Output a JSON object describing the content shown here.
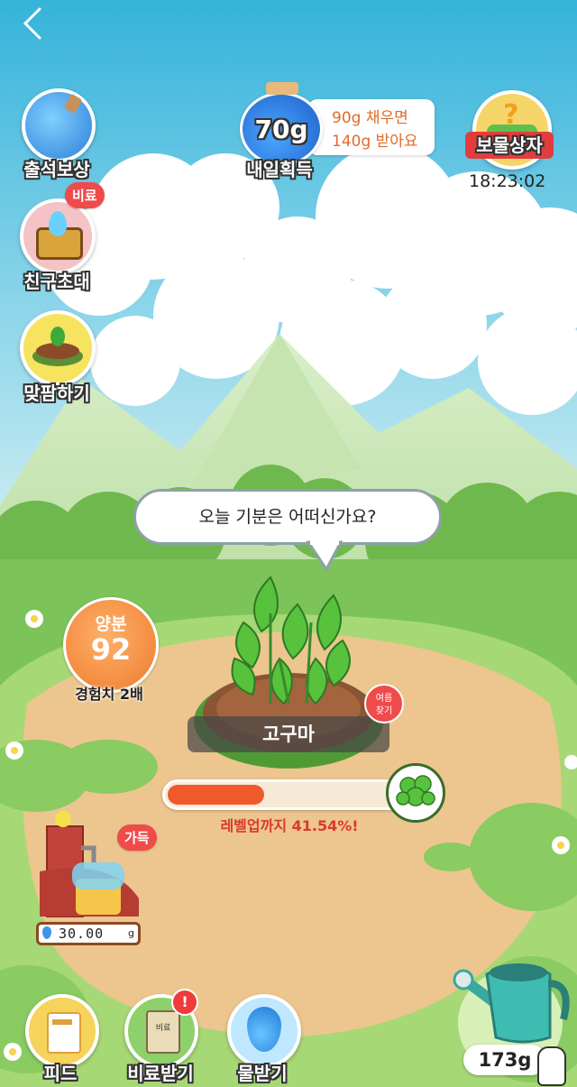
{
  "nav": {
    "back_icon": "chevron-left-icon"
  },
  "left_menu": [
    {
      "label": "출석보상",
      "icon": "potion-bottle-icon"
    },
    {
      "label": "친구초대",
      "icon": "treasure-chest-icon",
      "badge": "비료"
    },
    {
      "label": "맞팜하기",
      "icon": "plant-pot-icon"
    }
  ],
  "tomorrow": {
    "amount": "70g",
    "label": "내일획득",
    "tip_line1": "90g 채우면",
    "tip_line2": "140g 받아요"
  },
  "treasure": {
    "label": "보물상자",
    "timer": "18:23:02"
  },
  "speech": {
    "text": "오늘 기분은 어떠신가요?"
  },
  "nutrient": {
    "title": "양분",
    "value": "92",
    "caption": "경험치 2배"
  },
  "plant": {
    "name": "고구마",
    "harvest_tag_line1": "여름",
    "harvest_tag_line2": "찾기"
  },
  "progress": {
    "percent": 41.54,
    "text": "레벨업까지 41.54%!"
  },
  "water_tank": {
    "badge": "가득",
    "value": "30.00",
    "unit": "g"
  },
  "bottom_nav": [
    {
      "label": "피드",
      "icon": "feed-icon"
    },
    {
      "label": "비료받기",
      "icon": "fertilizer-bag-icon",
      "bag_text": "비료",
      "alert": "!"
    },
    {
      "label": "물받기",
      "icon": "water-drop-icon"
    }
  ],
  "watering_can": {
    "amount": "173g"
  },
  "colors": {
    "sky_top": "#3bb8dc",
    "grass": "#7cc35a",
    "dirt": "#e9c48b",
    "accent_red": "#ef4b4b",
    "orange": "#f08a3c"
  }
}
